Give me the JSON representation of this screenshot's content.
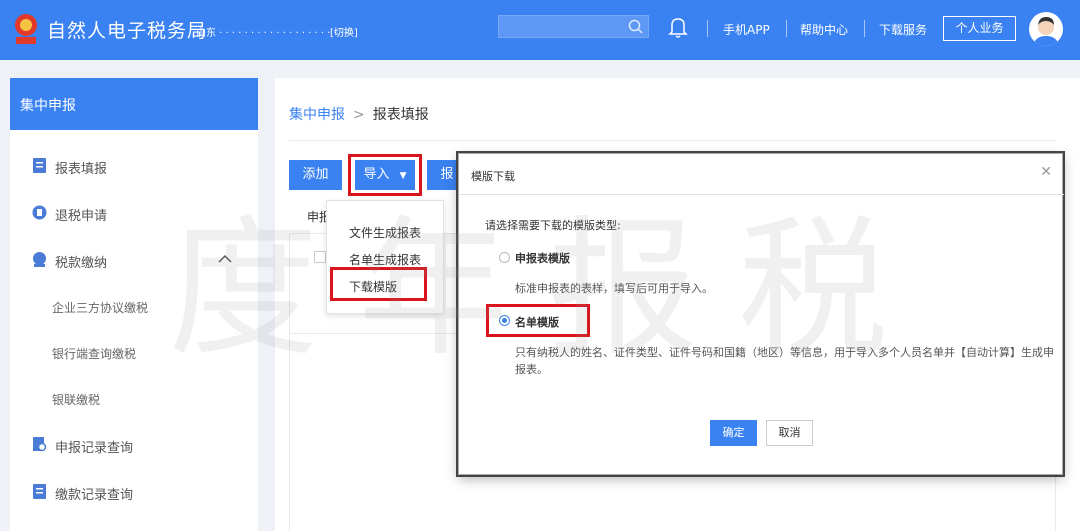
{
  "header": {
    "site_title": "自然人电子税务局",
    "region": "山东 · · · · · · · · · · · · · · · · · · · · ·",
    "switch_label": "[切换]",
    "links": [
      "手机APP",
      "帮助中心",
      "下载服务"
    ],
    "personal_button": "个人业务"
  },
  "sidebar": {
    "heading": "集中申报",
    "items": [
      {
        "label": "报表填报",
        "icon": "form-icon"
      },
      {
        "label": "退税申请",
        "icon": "refund-icon"
      },
      {
        "label": "税款缴纳",
        "icon": "payment-icon"
      },
      {
        "label": "申报记录查询",
        "icon": "record-search-icon"
      },
      {
        "label": "缴款记录查询",
        "icon": "payment-record-icon"
      }
    ],
    "sub_items": [
      "企业三方协议缴税",
      "银行端查询缴税",
      "银联缴税"
    ]
  },
  "main": {
    "breadcrumb": [
      "集中申报",
      "报表填报"
    ],
    "add_button": "添加",
    "import_button": "导入",
    "report_button_partial": "报",
    "column_header_partial": "申报"
  },
  "dropdown": {
    "items": [
      "文件生成报表",
      "名单生成报表",
      "下载模版"
    ]
  },
  "modal": {
    "title": "模版下载",
    "prompt": "请选择需要下载的模版类型:",
    "option1_label": "申报表模版",
    "option1_desc": "标准申报表的表样，填写后可用于导入。",
    "option2_label": "名单模版",
    "option2_desc_line1": "只有纳税人的姓名、证件类型、证件号码和国籍（地区）等信息，用于导入多个人员名单并【自动计算】生成申",
    "option2_desc_line2": "报表。",
    "selected_option": "名单模版",
    "ok_button": "确定",
    "cancel_button": "取消"
  },
  "watermark": "度年报税",
  "colors": {
    "primary": "#3a82f2",
    "highlight": "#d9141c"
  }
}
